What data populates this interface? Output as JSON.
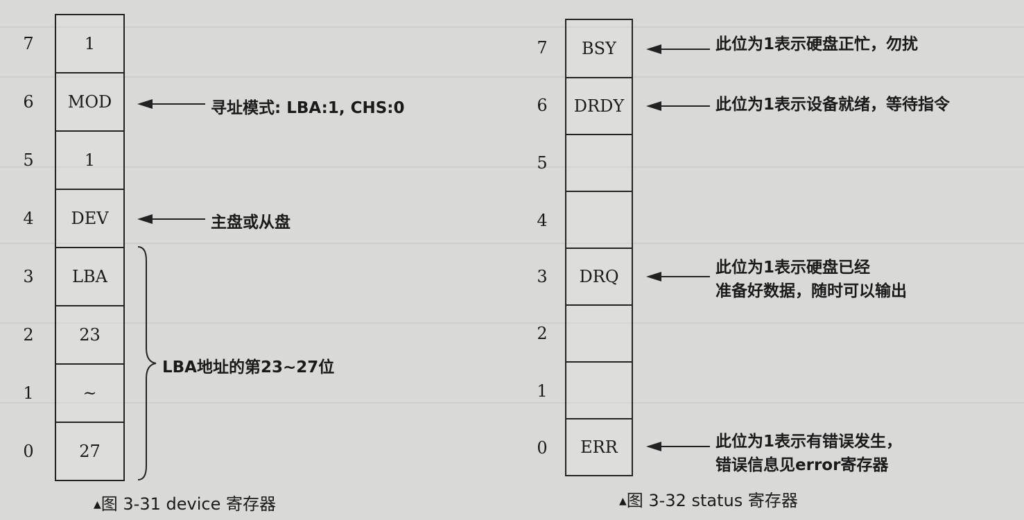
{
  "device_register": {
    "bits": [
      {
        "num": "7",
        "value": "1"
      },
      {
        "num": "6",
        "value": "MOD"
      },
      {
        "num": "5",
        "value": "1"
      },
      {
        "num": "4",
        "value": "DEV"
      },
      {
        "num": "3",
        "value": "LBA"
      },
      {
        "num": "2",
        "value": "23"
      },
      {
        "num": "1",
        "value": "~"
      },
      {
        "num": "0",
        "value": "27"
      }
    ],
    "notes": {
      "mod": "寻址模式: LBA:1, CHS:0",
      "dev": "主盘或从盘",
      "lba": "LBA地址的第23~27位"
    },
    "caption_marker": "▲",
    "caption": "图 3-31   device 寄存器"
  },
  "status_register": {
    "bits": [
      {
        "num": "7",
        "value": "BSY"
      },
      {
        "num": "6",
        "value": "DRDY"
      },
      {
        "num": "5",
        "value": ""
      },
      {
        "num": "4",
        "value": ""
      },
      {
        "num": "3",
        "value": "DRQ"
      },
      {
        "num": "2",
        "value": ""
      },
      {
        "num": "1",
        "value": ""
      },
      {
        "num": "0",
        "value": "ERR"
      }
    ],
    "notes": {
      "bsy": "此位为1表示硬盘正忙，勿扰",
      "drdy": "此位为1表示设备就绪，等待指令",
      "drq_line1": "此位为1表示硬盘已经",
      "drq_line2": "准备好数据，随时可以输出",
      "err_line1": "此位为1表示有错误发生，",
      "err_line2": "错误信息见error寄存器"
    },
    "caption_marker": "▲",
    "caption": "图 3-32   status 寄存器"
  }
}
